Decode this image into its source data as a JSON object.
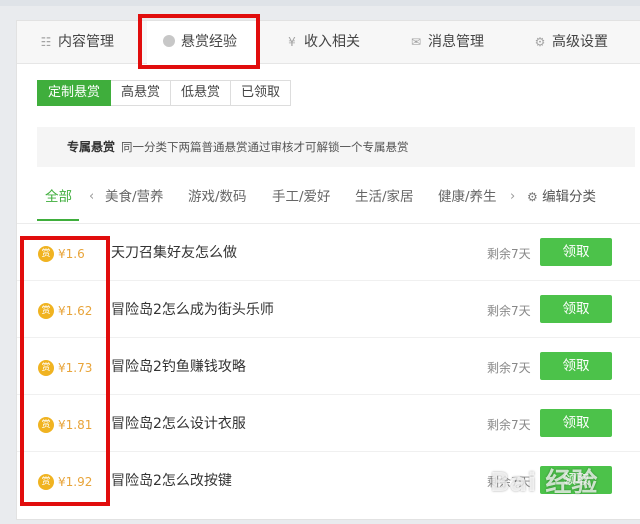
{
  "tabs": [
    {
      "label": "内容管理",
      "icon": "list-icon"
    },
    {
      "label": "悬赏经验",
      "icon": "coin-icon"
    },
    {
      "label": "收入相关",
      "icon": "yen-icon"
    },
    {
      "label": "消息管理",
      "icon": "mail-icon"
    },
    {
      "label": "高级设置",
      "icon": "gear-icon"
    }
  ],
  "filters": [
    "定制悬赏",
    "高悬赏",
    "低悬赏",
    "已领取"
  ],
  "info": {
    "title": "专属悬赏",
    "desc": "同一分类下两篇普通悬赏通过审核才可解锁一个专属悬赏"
  },
  "categories": [
    "全部",
    "美食/营养",
    "游戏/数码",
    "手工/爱好",
    "生活/家居",
    "健康/养生"
  ],
  "edit_categories": "编辑分类",
  "reward_badge": "赏",
  "items": [
    {
      "amount": "¥1.6",
      "title": "天刀召集好友怎么做",
      "remain": "剩余7天",
      "action": "领取"
    },
    {
      "amount": "¥1.62",
      "title": "冒险岛2怎么成为街头乐师",
      "remain": "剩余7天",
      "action": "领取"
    },
    {
      "amount": "¥1.73",
      "title": "冒险岛2钓鱼赚钱攻略",
      "remain": "剩余7天",
      "action": "领取"
    },
    {
      "amount": "¥1.81",
      "title": "冒险岛2怎么设计衣服",
      "remain": "剩余7天",
      "action": "领取"
    },
    {
      "amount": "¥1.92",
      "title": "冒险岛2怎么改按键",
      "remain": "剩余7天",
      "action": "领取"
    }
  ],
  "watermark": "Bai 经验",
  "colors": {
    "accent": "#3fae3c",
    "button": "#4cc24a",
    "reward": "#e8a43a",
    "annotation": "#e10d0d"
  }
}
